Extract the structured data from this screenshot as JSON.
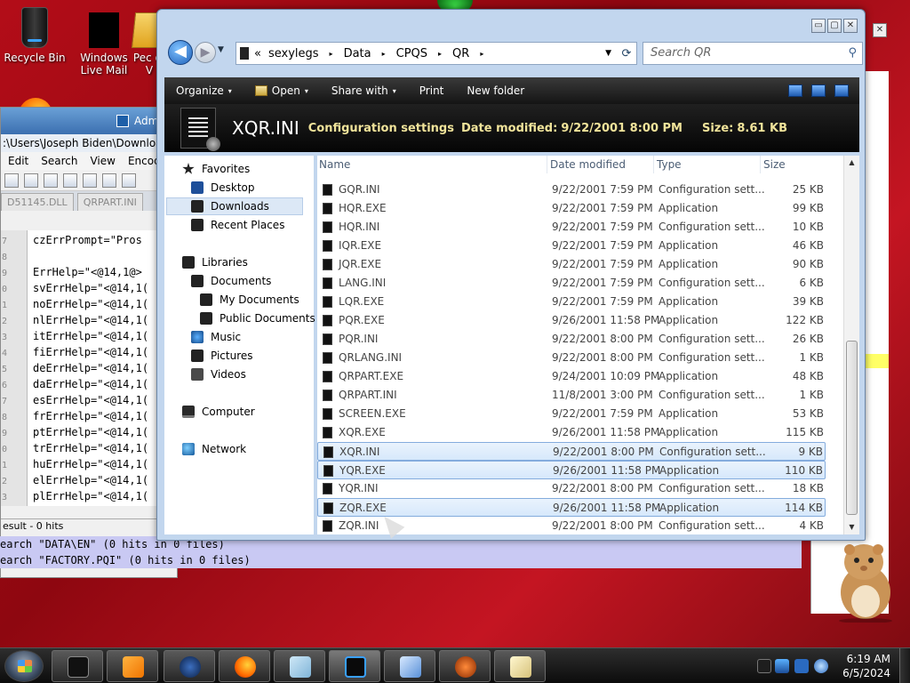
{
  "desktop": {
    "icons": [
      {
        "label": "Recycle Bin",
        "icon": "recycle-bin-icon"
      },
      {
        "label": "Windows Live Mail",
        "icon": "mail-icon"
      },
      {
        "label": "Pec of V",
        "icon": "folder-icon"
      }
    ]
  },
  "notepad": {
    "title": "Adm",
    "path": ":\\Users\\Joseph Biden\\Downloads\\",
    "menu": [
      "Edit",
      "Search",
      "View",
      "Encoding"
    ],
    "tabs": [
      "D51145.DLL",
      "QRPART.INI"
    ],
    "lines": [
      {
        "n": "7",
        "t": "czErrPrompt=\"Pros"
      },
      {
        "n": "8",
        "t": ""
      },
      {
        "n": "9",
        "t": "ErrHelp=\"<@14,1@>"
      },
      {
        "n": "0",
        "t": "svErrHelp=\"<@14,1("
      },
      {
        "n": "1",
        "t": "noErrHelp=\"<@14,1("
      },
      {
        "n": "2",
        "t": "nlErrHelp=\"<@14,1("
      },
      {
        "n": "3",
        "t": "itErrHelp=\"<@14,1("
      },
      {
        "n": "4",
        "t": "fiErrHelp=\"<@14,1("
      },
      {
        "n": "5",
        "t": "deErrHelp=\"<@14,1("
      },
      {
        "n": "6",
        "t": "daErrHelp=\"<@14,1("
      },
      {
        "n": "7",
        "t": "esErrHelp=\"<@14,1("
      },
      {
        "n": "8",
        "t": "frErrHelp=\"<@14,1("
      },
      {
        "n": "9",
        "t": "ptErrHelp=\"<@14,1("
      },
      {
        "n": "0",
        "t": "trErrHelp=\"<@14,1("
      },
      {
        "n": "1",
        "t": "huErrHelp=\"<@14,1("
      },
      {
        "n": "2",
        "t": "elErrHelp=\"<@14,1("
      },
      {
        "n": "3",
        "t": "plErrHelp=\"<@14,1("
      }
    ],
    "status": "esult - 0 hits"
  },
  "search_results": [
    "earch \"DATA\\EN\" (0 hits in 0 files)",
    "earch \"FACTORY.PQI\" (0 hits in 0 files)"
  ],
  "explorer": {
    "window_controls": {
      "minimize": "▭",
      "maximize": "▢",
      "close": "✕"
    },
    "nav": {
      "back": "◀",
      "forward": "▶"
    },
    "breadcrumb": [
      "sexylegs",
      "Data",
      "CPQS",
      "QR"
    ],
    "crumb_prefix": "«",
    "crumb_sep": "▸",
    "search_placeholder": "Search QR",
    "toolbar": {
      "organize": "Organize",
      "open": "Open",
      "share_with": "Share with",
      "print": "Print",
      "new_folder": "New folder",
      "caret": "▾"
    },
    "details": {
      "file_name": "XQR.INI",
      "file_type": "Configuration settings",
      "date_label": "Date modified:",
      "date_value": "9/22/2001 8:00 PM",
      "size_label": "Size:",
      "size_value": "8.61 KB"
    },
    "nav_pane": {
      "favorites": "Favorites",
      "desktop": "Desktop",
      "downloads": "Downloads",
      "recent_places": "Recent Places",
      "libraries": "Libraries",
      "documents": "Documents",
      "my_documents": "My Documents",
      "public_documents": "Public Documents",
      "music": "Music",
      "pictures": "Pictures",
      "videos": "Videos",
      "computer": "Computer",
      "network": "Network"
    },
    "columns": {
      "name": "Name",
      "date": "Date modified",
      "type": "Type",
      "size": "Size"
    },
    "files": [
      {
        "name": "GQR.INI",
        "date": "9/22/2001 7:59 PM",
        "type": "Configuration sett...",
        "size": "25 KB",
        "selected": false
      },
      {
        "name": "HQR.EXE",
        "date": "9/22/2001 7:59 PM",
        "type": "Application",
        "size": "99 KB",
        "selected": false
      },
      {
        "name": "HQR.INI",
        "date": "9/22/2001 7:59 PM",
        "type": "Configuration sett...",
        "size": "10 KB",
        "selected": false
      },
      {
        "name": "IQR.EXE",
        "date": "9/22/2001 7:59 PM",
        "type": "Application",
        "size": "46 KB",
        "selected": false
      },
      {
        "name": "JQR.EXE",
        "date": "9/22/2001 7:59 PM",
        "type": "Application",
        "size": "90 KB",
        "selected": false
      },
      {
        "name": "LANG.INI",
        "date": "9/22/2001 7:59 PM",
        "type": "Configuration sett...",
        "size": "6 KB",
        "selected": false
      },
      {
        "name": "LQR.EXE",
        "date": "9/22/2001 7:59 PM",
        "type": "Application",
        "size": "39 KB",
        "selected": false
      },
      {
        "name": "PQR.EXE",
        "date": "9/26/2001 11:58 PM",
        "type": "Application",
        "size": "122 KB",
        "selected": false
      },
      {
        "name": "PQR.INI",
        "date": "9/22/2001 8:00 PM",
        "type": "Configuration sett...",
        "size": "26 KB",
        "selected": false
      },
      {
        "name": "QRLANG.INI",
        "date": "9/22/2001 8:00 PM",
        "type": "Configuration sett...",
        "size": "1 KB",
        "selected": false
      },
      {
        "name": "QRPART.EXE",
        "date": "9/24/2001 10:09 PM",
        "type": "Application",
        "size": "48 KB",
        "selected": false
      },
      {
        "name": "QRPART.INI",
        "date": "11/8/2001 3:00 PM",
        "type": "Configuration sett...",
        "size": "1 KB",
        "selected": false
      },
      {
        "name": "SCREEN.EXE",
        "date": "9/22/2001 7:59 PM",
        "type": "Application",
        "size": "53 KB",
        "selected": false
      },
      {
        "name": "XQR.EXE",
        "date": "9/26/2001 11:58 PM",
        "type": "Application",
        "size": "115 KB",
        "selected": false
      },
      {
        "name": "XQR.INI",
        "date": "9/22/2001 8:00 PM",
        "type": "Configuration sett...",
        "size": "9 KB",
        "selected": true
      },
      {
        "name": "YQR.EXE",
        "date": "9/26/2001 11:58 PM",
        "type": "Application",
        "size": "110 KB",
        "selected": true
      },
      {
        "name": "YQR.INI",
        "date": "9/22/2001 8:00 PM",
        "type": "Configuration sett...",
        "size": "18 KB",
        "selected": false
      },
      {
        "name": "ZQR.EXE",
        "date": "9/26/2001 11:58 PM",
        "type": "Application",
        "size": "114 KB",
        "selected": true
      },
      {
        "name": "ZQR.INI",
        "date": "9/22/2001 8:00 PM",
        "type": "Configuration sett...",
        "size": "4 KB",
        "selected": false
      }
    ]
  },
  "taskbar": {
    "apps": [
      "cmd-app",
      "media-player-app",
      "globe-app",
      "firefox-app",
      "notepad-app",
      "explorer-app",
      "media-center-app",
      "burner-app",
      "notepad-plus-app"
    ],
    "clock_time": "6:19 AM",
    "clock_date": "6/5/2024"
  }
}
